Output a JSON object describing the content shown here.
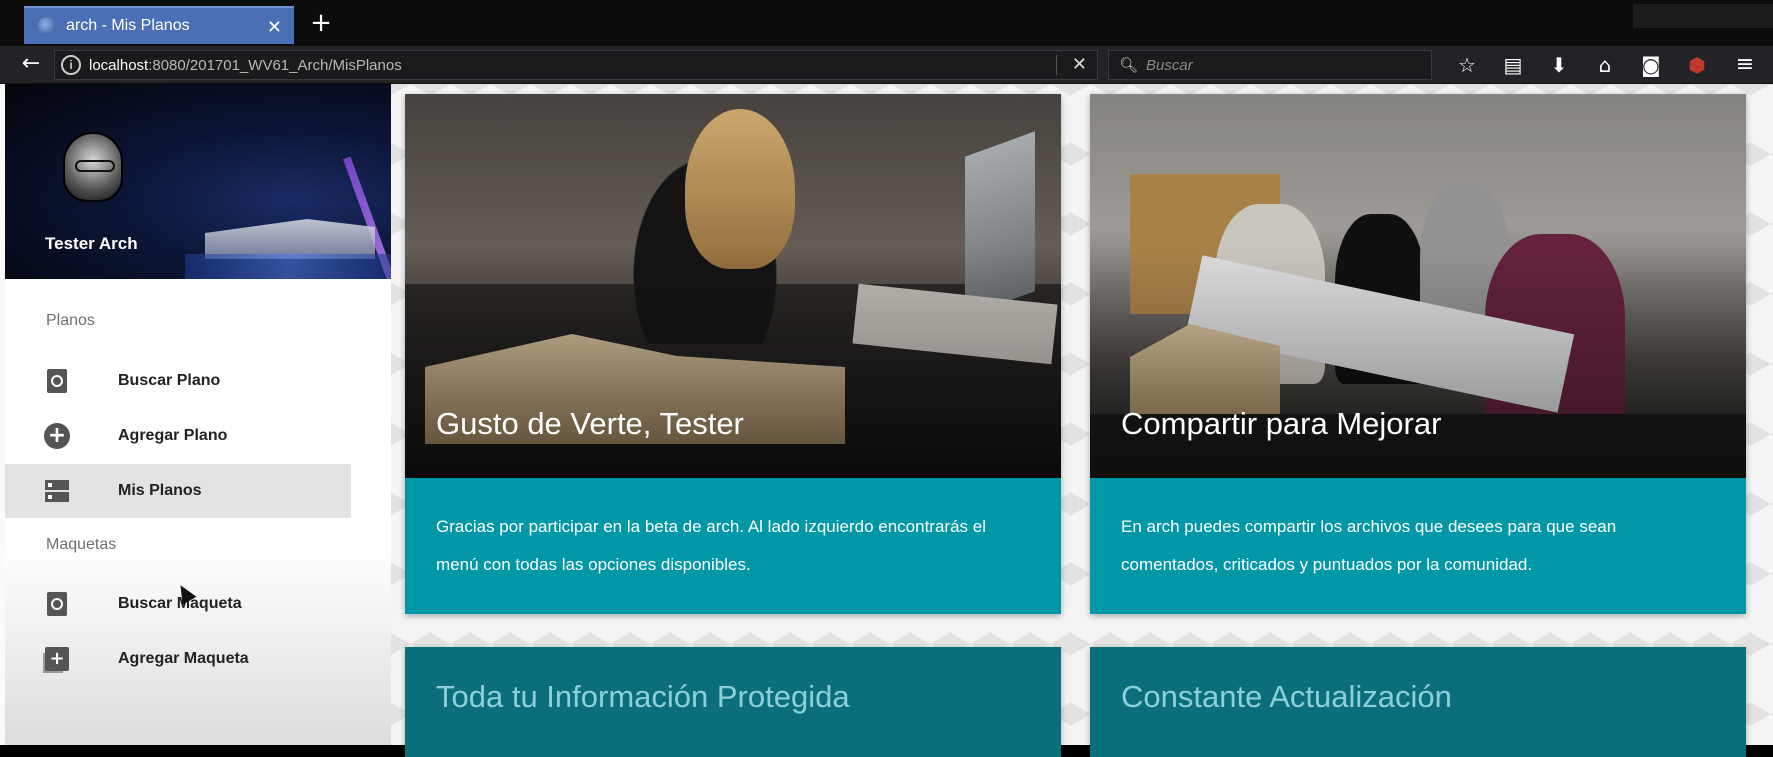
{
  "browser": {
    "tab_title": "arch - Mis Planos",
    "tab_close": "✕",
    "new_tab": "+",
    "url_host": "localhost",
    "url_path": ":8080/201701_WV61_Arch/MisPlanos",
    "url_clear": "✕",
    "search_placeholder": "Buscar",
    "icons": [
      "star-icon",
      "reader-icon",
      "download-icon",
      "home-icon",
      "pocket-icon",
      "ublock-icon",
      "menu-icon"
    ]
  },
  "sidebar": {
    "user_name": "Tester Arch",
    "sections": [
      {
        "title": "Planos",
        "items": [
          {
            "label": "Buscar Plano",
            "icon": "search-document-icon"
          },
          {
            "label": "Agregar Plano",
            "icon": "add-circle-icon"
          },
          {
            "label": "Mis Planos",
            "icon": "storage-icon",
            "active": true
          }
        ]
      },
      {
        "title": "Maquetas",
        "items": [
          {
            "label": "Buscar Maqueta",
            "icon": "search-document-icon"
          },
          {
            "label": "Agregar Maqueta",
            "icon": "add-box-icon"
          }
        ]
      }
    ]
  },
  "cards": [
    {
      "title": "Gusto de Verte, Tester",
      "text": "Gracias por participar en la beta de arch. Al lado izquierdo encontrarás el menú con todas las opciones disponibles."
    },
    {
      "title": "Compartir para Mejorar",
      "text": "En arch puedes compartir los archivos que desees para que sean comentados, criticados y puntuados por la comunidad."
    },
    {
      "title": "Toda tu Información Protegida"
    },
    {
      "title": "Constante Actualización"
    }
  ],
  "colors": {
    "card_teal": "#0097a7",
    "tab_blue": "#4a6fb5",
    "active_item_bg": "#e3e3e3"
  }
}
